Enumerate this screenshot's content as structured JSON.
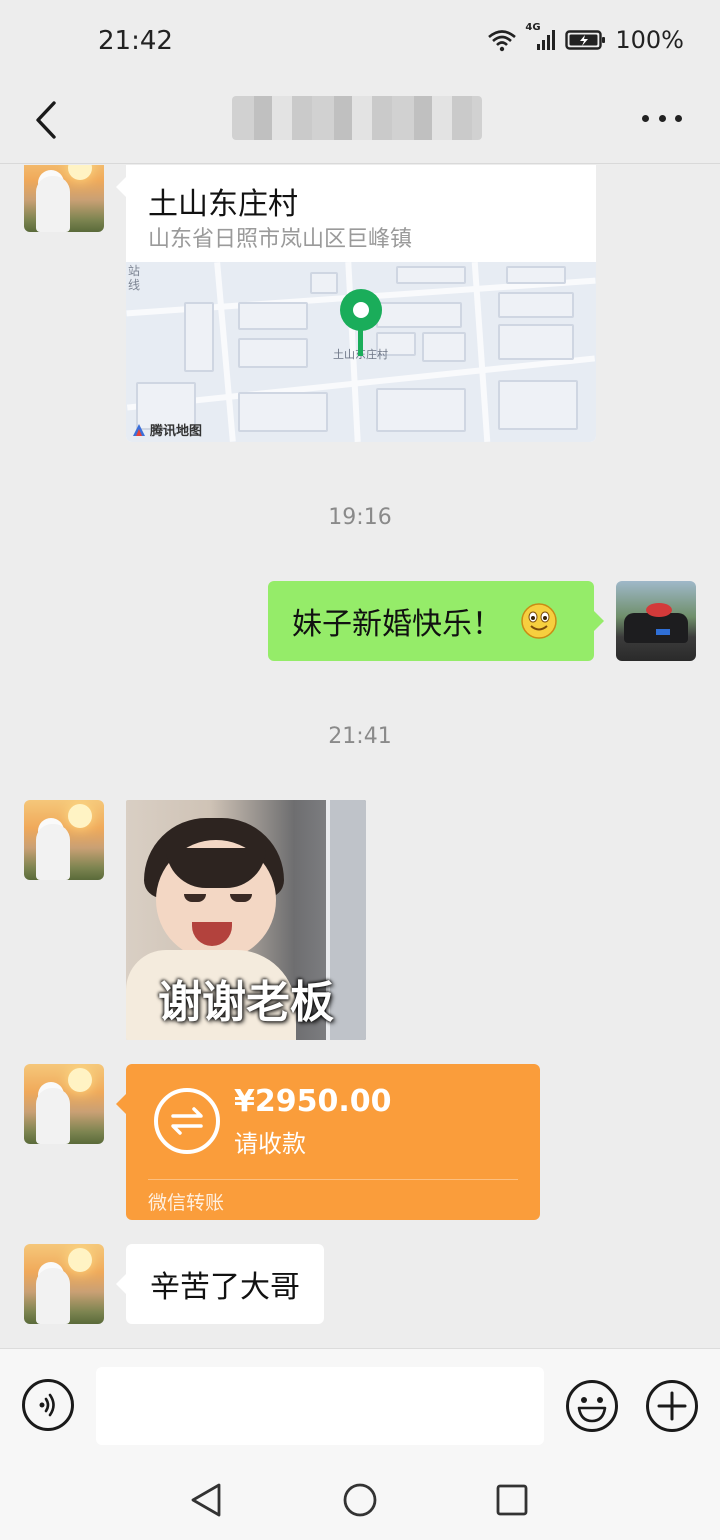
{
  "status_bar": {
    "time": "21:42",
    "network": "4G",
    "battery": "100%"
  },
  "header": {
    "title": "",
    "back_icon": "chevron-left-icon",
    "more_icon": "more-horizontal-icon"
  },
  "messages": {
    "location": {
      "title": "土山东庄村",
      "address": "山东省日照市岚山区巨峰镇",
      "map_pin_label": "土山东庄村",
      "map_station_label": "站\n线",
      "map_provider": "腾讯地图"
    },
    "timestamp_1": "19:16",
    "outgoing_text": "妹子新婚快乐！",
    "outgoing_emoji": "smile-emoji",
    "timestamp_2": "21:41",
    "sticker_caption": "谢谢老板",
    "transfer": {
      "amount": "¥2950.00",
      "status": "请收款",
      "label": "微信转账",
      "color": "#fa9d3b"
    },
    "incoming_text": "辛苦了大哥"
  },
  "input_bar": {
    "value": "",
    "placeholder": ""
  },
  "colors": {
    "background": "#ededed",
    "outgoing_bubble": "#95ec69",
    "incoming_bubble": "#ffffff",
    "map_pin": "#1aad5a"
  }
}
